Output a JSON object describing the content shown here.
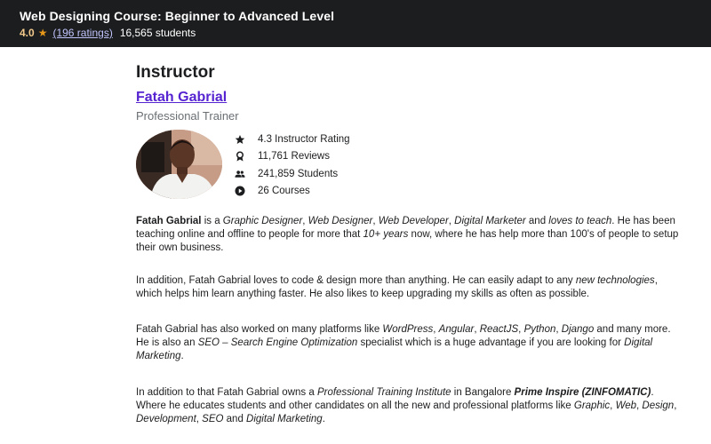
{
  "header": {
    "course_title": "Web Designing Course: Beginner to Advanced Level",
    "rating": "4.0",
    "ratings_count": "(196 ratings)",
    "students": "16,565 students"
  },
  "instructor": {
    "section_title": "Instructor",
    "name": "Fatah Gabrial",
    "job_title": "Professional Trainer",
    "stats": [
      {
        "icon": "star-icon",
        "label": "4.3 Instructor Rating"
      },
      {
        "icon": "award-icon",
        "label": "11,761 Reviews"
      },
      {
        "icon": "users-icon",
        "label": "241,859 Students"
      },
      {
        "icon": "play-icon",
        "label": "26 Courses"
      }
    ]
  },
  "bio": {
    "p1": [
      {
        "t": "Fatah Gabrial",
        "s": "b"
      },
      {
        "t": " is a ",
        "s": ""
      },
      {
        "t": "Graphic Designer",
        "s": "i"
      },
      {
        "t": ", ",
        "s": ""
      },
      {
        "t": "Web Designer",
        "s": "i"
      },
      {
        "t": ", ",
        "s": ""
      },
      {
        "t": "Web Developer",
        "s": "i"
      },
      {
        "t": ", ",
        "s": ""
      },
      {
        "t": "Digital Marketer",
        "s": "i"
      },
      {
        "t": " and ",
        "s": ""
      },
      {
        "t": "loves to teach",
        "s": "i"
      },
      {
        "t": ". He has been teaching online and offline to people for more that ",
        "s": ""
      },
      {
        "t": "10+ years",
        "s": "i"
      },
      {
        "t": " now, where he has help more than 100's of people to setup their own business.",
        "s": ""
      }
    ],
    "p2": [
      {
        "t": "In addition, Fatah Gabrial loves to code & design more than anything. He can easily adapt to any ",
        "s": ""
      },
      {
        "t": "new technologies",
        "s": "i"
      },
      {
        "t": ", which helps him learn anything faster. He also likes to keep upgrading my skills as often as possible.",
        "s": ""
      }
    ],
    "p3": [
      {
        "t": "Fatah Gabrial has also worked on many platforms like ",
        "s": ""
      },
      {
        "t": "WordPress",
        "s": "i"
      },
      {
        "t": ", ",
        "s": ""
      },
      {
        "t": "Angular",
        "s": "i"
      },
      {
        "t": ", ",
        "s": ""
      },
      {
        "t": "ReactJS",
        "s": "i"
      },
      {
        "t": ", ",
        "s": ""
      },
      {
        "t": "Python",
        "s": "i"
      },
      {
        "t": ", ",
        "s": ""
      },
      {
        "t": "Django",
        "s": "i"
      },
      {
        "t": " and many more. He is also an ",
        "s": ""
      },
      {
        "t": "SEO – Search Engine Optimization",
        "s": "i"
      },
      {
        "t": " specialist which is a huge advantage if you are looking for ",
        "s": ""
      },
      {
        "t": "Digital Marketing",
        "s": "i"
      },
      {
        "t": ".",
        "s": ""
      }
    ],
    "p4": [
      {
        "t": "In addition to that Fatah Gabrial owns a ",
        "s": ""
      },
      {
        "t": "Professional Training Institute",
        "s": "i"
      },
      {
        "t": " in Bangalore ",
        "s": ""
      },
      {
        "t": "Prime Inspire (ZINFOMATIC)",
        "s": "bi"
      },
      {
        "t": ". Where he educates students and other candidates on all the new and professional platforms like ",
        "s": ""
      },
      {
        "t": "Graphic",
        "s": "i"
      },
      {
        "t": ", ",
        "s": ""
      },
      {
        "t": "Web",
        "s": "i"
      },
      {
        "t": ", ",
        "s": ""
      },
      {
        "t": "Design",
        "s": "i"
      },
      {
        "t": ", ",
        "s": ""
      },
      {
        "t": "Development",
        "s": "i"
      },
      {
        "t": ", ",
        "s": ""
      },
      {
        "t": "SEO",
        "s": "i"
      },
      {
        "t": " and ",
        "s": ""
      },
      {
        "t": "Digital Marketing",
        "s": "i"
      },
      {
        "t": ".",
        "s": ""
      }
    ]
  },
  "colors": {
    "topbar_bg": "#1c1d1f",
    "rating_gold": "#f3ca8c",
    "link_purple": "#5624d0",
    "ratings_link": "#c0c4fc"
  }
}
